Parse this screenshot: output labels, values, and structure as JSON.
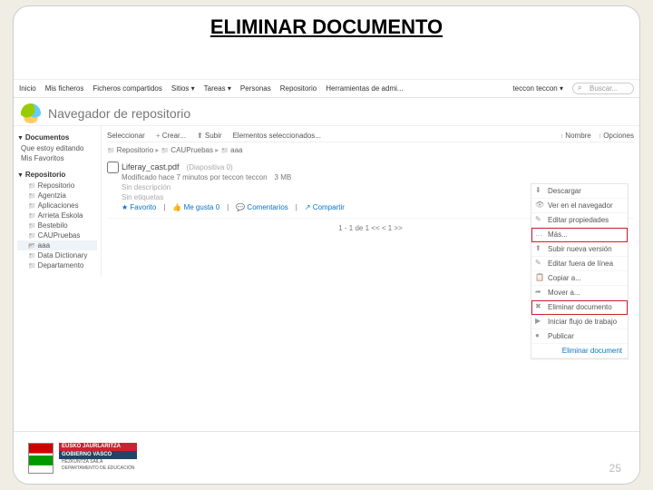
{
  "slide": {
    "title": "ELIMINAR DOCUMENTO",
    "page_number": "25"
  },
  "topnav": {
    "items": [
      "Inicio",
      "Mis ficheros",
      "Ficheros compartidos",
      "Sitios ▾",
      "Tareas ▾",
      "Personas",
      "Repositorio",
      "Herramientas de admi..."
    ],
    "user": "teccon teccon ▾",
    "search_placeholder": "Buscar..."
  },
  "page": {
    "heading": "Navegador de repositorio"
  },
  "sidebar": {
    "docs_label": "Documentos",
    "docs_items": [
      "Que estoy editando",
      "Mis Favoritos"
    ],
    "repo_label": "Repositorio",
    "repo_root": "Repositorio",
    "repo_items": [
      "Agentzia",
      "Aplicaciones",
      "Arrieta Eskola",
      "Bestebilo",
      "CAUPruebas",
      "aaa",
      "Data Dictionary",
      "Departamento"
    ],
    "selected_index": 5
  },
  "toolbar": {
    "select": "Seleccionar",
    "create": "Crear...",
    "upload": "Subir",
    "selected": "Elementos seleccionados...",
    "sort_name": "Nombre",
    "sort_opts": "Opciones"
  },
  "breadcrumb": {
    "items": [
      "Repositorio",
      "CAUPruebas",
      "aaa"
    ]
  },
  "entry": {
    "filename": "Liferay_cast.pdf",
    "slide_info": "(Diapositiva 0)",
    "modified": "Modificado hace 7 minutos por teccon teccon",
    "size": "3 MB",
    "no_desc": "Sin descripción",
    "no_tags": "Sin etiquetas",
    "actions": {
      "fav": "Favorito",
      "like": "Me gusta 0",
      "comment": "Comentarios",
      "share": "Compartir"
    }
  },
  "pager": {
    "text": "1 - 1 de 1   <<   <   1   >>"
  },
  "context_menu": {
    "items": [
      {
        "icon": "⬇",
        "label": "Descargar"
      },
      {
        "icon": "👁",
        "label": "Ver en el navegador"
      },
      {
        "icon": "✎",
        "label": "Editar propiedades"
      },
      {
        "icon": "…",
        "label": "Más...",
        "hl": true
      },
      {
        "icon": "⬆",
        "label": "Subir nueva versión"
      },
      {
        "icon": "✎",
        "label": "Editar fuera de línea"
      },
      {
        "icon": "📋",
        "label": "Copiar a..."
      },
      {
        "icon": "➦",
        "label": "Mover a..."
      },
      {
        "icon": "✖",
        "label": "Eliminar documento",
        "hl": true
      },
      {
        "icon": "▶",
        "label": "Iniciar flujo de trabajo"
      },
      {
        "icon": "●",
        "label": "Publicar"
      }
    ],
    "footer_action": "Eliminar document"
  },
  "gov": {
    "line1": "EUSKO JAURLARITZA",
    "line2": "GOBIERNO VASCO",
    "dept1": "HEZKUNTZA SAILA",
    "dept2": "DEPARTAMENTO DE EDUCACIÓN"
  }
}
